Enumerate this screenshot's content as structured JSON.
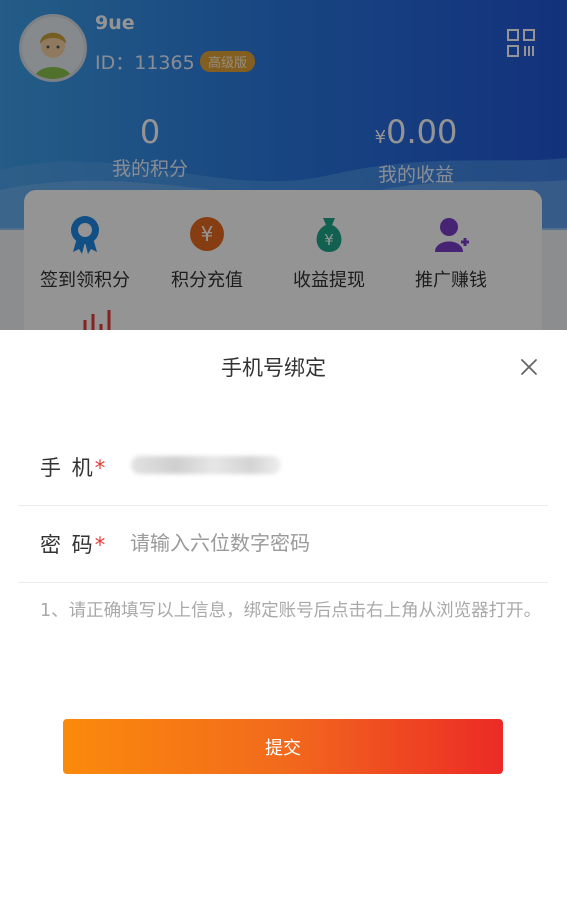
{
  "profile": {
    "username": "9ue",
    "user_id": "ID：11365",
    "vip_badge": "高级版",
    "qr_icon": "qr-code-icon"
  },
  "stats": {
    "points_value": "0",
    "points_label": "我的积分",
    "earnings_currency": "¥",
    "earnings_value": "0.00",
    "earnings_label": "我的收益"
  },
  "menu": {
    "items": [
      {
        "label": "签到领积分",
        "icon": "badge-ribbon-icon",
        "color": "#1e88e5"
      },
      {
        "label": "积分充值",
        "icon": "yuan-coin-icon",
        "color": "#e96a1f"
      },
      {
        "label": "收益提现",
        "icon": "money-bag-icon",
        "color": "#1fa88a"
      },
      {
        "label": "推广赚钱",
        "icon": "user-add-icon",
        "color": "#7b3fc6"
      }
    ],
    "extra_icon": "bar-chart-icon"
  },
  "modal": {
    "title": "手机号绑定",
    "phone_label": "手 机",
    "password_label": "密 码",
    "required_mark": "*",
    "password_placeholder": "请输入六位数字密码",
    "hint": "1、请正确填写以上信息，绑定账号后点击右上角从浏览器打开。",
    "submit_label": "提交"
  },
  "colors": {
    "header_start": "#3ea0e8",
    "header_end": "#2256d6",
    "button_start": "#fb8a0c",
    "button_end": "#ec2a26",
    "required": "#e53935"
  }
}
